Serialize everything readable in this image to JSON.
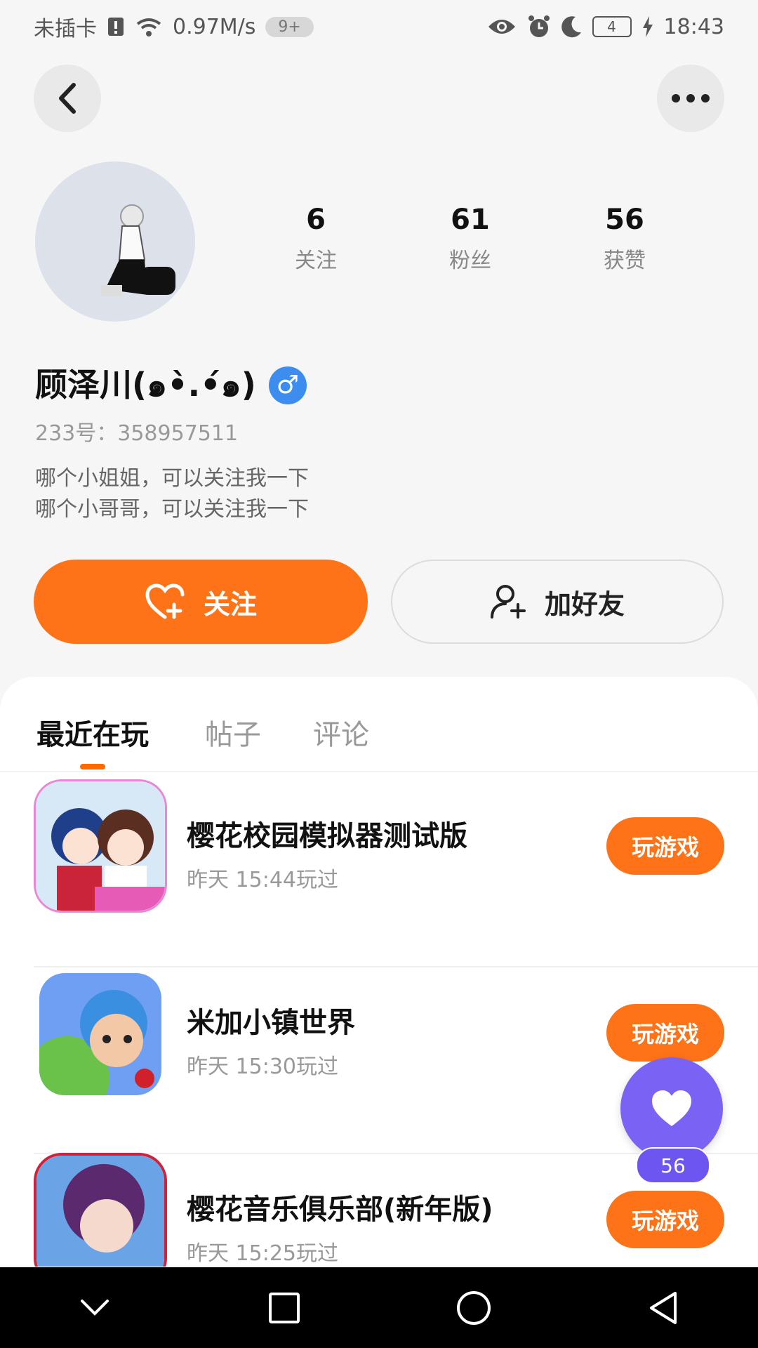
{
  "status_bar": {
    "carrier": "未插卡",
    "speed": "0.97M/s",
    "notif_badge": "9+",
    "battery": "4",
    "time": "18:43"
  },
  "profile": {
    "stats": [
      {
        "value": "6",
        "label": "关注"
      },
      {
        "value": "61",
        "label": "粉丝"
      },
      {
        "value": "56",
        "label": "获赞"
      }
    ],
    "username": "顾泽川(๑•̀.•́๑)",
    "gender_symbol": "♂",
    "uid": "233号：358957511",
    "bio_lines": [
      "哪个小姐姐，可以关注我一下",
      "哪个小哥哥，可以关注我一下"
    ]
  },
  "actions": {
    "follow_label": "关注",
    "add_friend_label": "加好友"
  },
  "tabs": [
    {
      "label": "最近在玩",
      "active": true
    },
    {
      "label": "帖子",
      "active": false
    },
    {
      "label": "评论",
      "active": false
    }
  ],
  "games": [
    {
      "title": "樱花校园模拟器测试版",
      "time": "昨天 15:44玩过",
      "button": "玩游戏"
    },
    {
      "title": "米加小镇世界",
      "time": "昨天 15:30玩过",
      "button": "玩游戏"
    },
    {
      "title": "樱花音乐俱乐部(新年版)",
      "time": "昨天 15:25玩过",
      "button": "玩游戏"
    }
  ],
  "like_fab": {
    "count": "56"
  },
  "colors": {
    "accent": "#ff7318",
    "fab": "#7a62f5",
    "gender": "#3d8df0"
  }
}
